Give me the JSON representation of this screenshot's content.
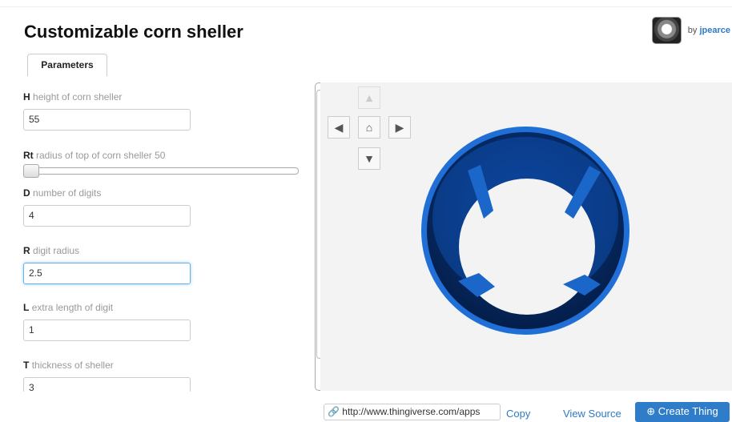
{
  "page": {
    "title": "Customizable corn sheller"
  },
  "author": {
    "prefix": "by",
    "name": "jpearce"
  },
  "tabs": [
    {
      "label": "Parameters"
    }
  ],
  "params": [
    {
      "key": "H",
      "desc": "height of corn sheller",
      "value": "55"
    },
    {
      "key": "Rt",
      "desc": "radius of top of corn sheller 50",
      "slider_value": 50
    },
    {
      "key": "D",
      "desc": "number of digits",
      "value": "4"
    },
    {
      "key": "R",
      "desc": "digit radius",
      "value": "2.5"
    },
    {
      "key": "L",
      "desc": "extra length of digit",
      "value": "1"
    },
    {
      "key": "T",
      "desc": "thickness of sheller",
      "value": "3"
    }
  ],
  "viewer": {
    "model_color": "#1e6fd4",
    "nav": {
      "up": "up-arrow-icon",
      "left": "left-arrow-icon",
      "home": "home-icon",
      "right": "right-arrow-icon",
      "down": "down-arrow-icon"
    }
  },
  "footer": {
    "url_value": "http://www.thingiverse.com/apps",
    "copy_label": "Copy",
    "view_source_label": "View Source",
    "create_label": "Create Thing"
  }
}
